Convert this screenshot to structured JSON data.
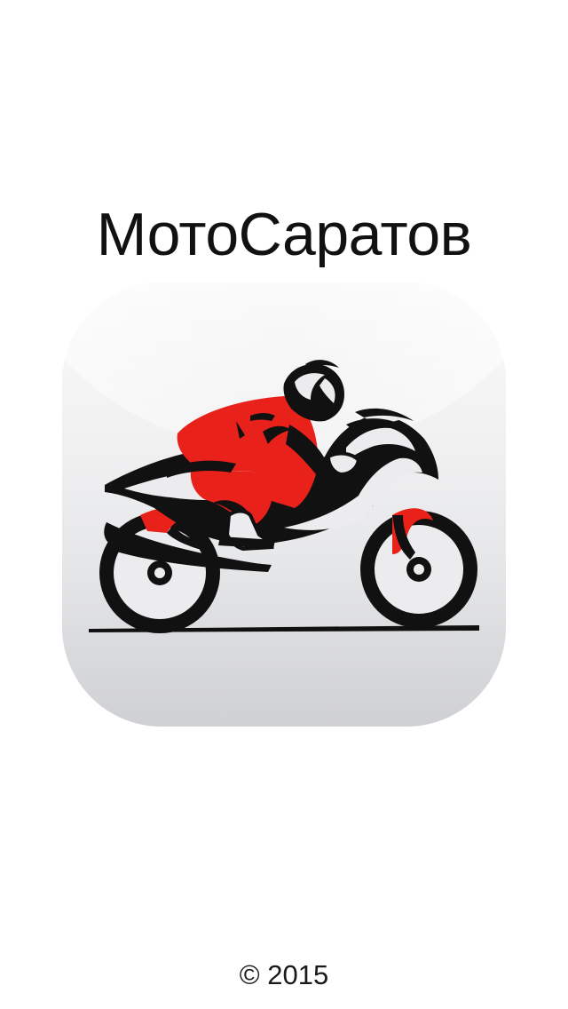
{
  "splash": {
    "title": "МотоСаратов",
    "copyright": "© 2015"
  },
  "logo": {
    "icon": "motorcycle-rider-icon",
    "accent_color": "#e8211a",
    "ink_color": "#111111"
  }
}
